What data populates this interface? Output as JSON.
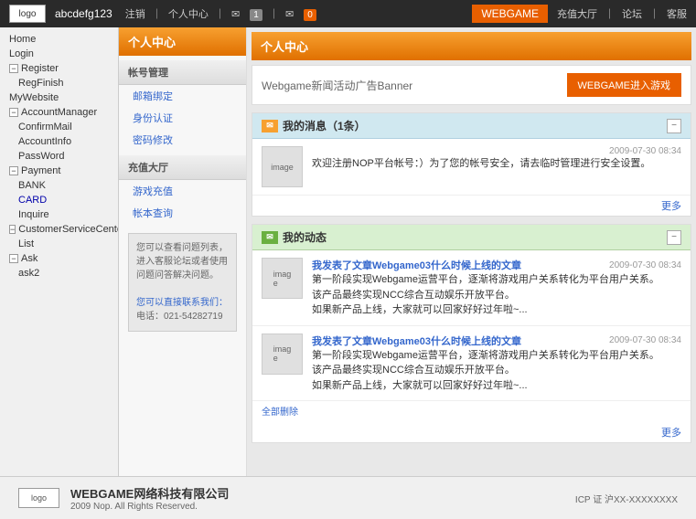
{
  "header": {
    "logo_text": "logo",
    "username": "abcdefg123",
    "links": {
      "logout": "注销",
      "profile": "个人中心",
      "mail_label": "",
      "badge_count": "1",
      "msg_label": "",
      "msg_count": "0"
    },
    "webgame_btn": "WEBGAME",
    "right_links": {
      "recharge": "充值大厅",
      "forum": "论坛",
      "service": "客服"
    }
  },
  "left_tree": {
    "items": [
      {
        "label": "Home",
        "level": 0,
        "has_expander": false
      },
      {
        "label": "Login",
        "level": 0,
        "has_expander": false
      },
      {
        "label": "Register",
        "level": 0,
        "has_expander": true,
        "expanded": true
      },
      {
        "label": "RegFinish",
        "level": 1,
        "has_expander": false
      },
      {
        "label": "MyWebsite",
        "level": 0,
        "has_expander": false
      },
      {
        "label": "AccountManager",
        "level": 0,
        "has_expander": true,
        "expanded": true
      },
      {
        "label": "ConfirmMail",
        "level": 1,
        "has_expander": false
      },
      {
        "label": "AccountInfo",
        "level": 1,
        "has_expander": false
      },
      {
        "label": "PassWord",
        "level": 1,
        "has_expander": false
      },
      {
        "label": "Payment",
        "level": 0,
        "has_expander": true,
        "expanded": true
      },
      {
        "label": "BANK",
        "level": 1,
        "has_expander": false
      },
      {
        "label": "CARD",
        "level": 1,
        "has_expander": false,
        "selected": true
      },
      {
        "label": "Inquire",
        "level": 1,
        "has_expander": false
      },
      {
        "label": "CustomerServiceCenter",
        "level": 0,
        "has_expander": true,
        "expanded": true
      },
      {
        "label": "List",
        "level": 1,
        "has_expander": false
      },
      {
        "label": "Ask",
        "level": 0,
        "has_expander": true,
        "expanded": true
      },
      {
        "label": "ask2",
        "level": 1,
        "has_expander": false
      }
    ]
  },
  "center_panel": {
    "title": "个人中心",
    "sections": [
      {
        "title": "帐号管理",
        "links": [
          "邮箱绑定",
          "身份认证",
          "密码修改"
        ]
      },
      {
        "title": "充值大厅",
        "links": [
          "游戏充值",
          "帐本查询"
        ]
      }
    ],
    "footer_text": "您可以查看问题列表，进入客服论坛或者使用问题问答解决问题。",
    "footer_link": "您可以直接联系我们：",
    "footer_phone": "电话：021-54282719"
  },
  "content": {
    "title": "个人中心",
    "banner_text": "Webgame新闻活动广告Banner",
    "webgame_enter_btn": "WEBGAME进入游戏",
    "messages_section": {
      "title": "我的消息（1条）",
      "items": [
        {
          "image_label": "image",
          "text": "欢迎注册NOP平台帐号：）为了您的帐号安全，请去临时管理进行安全设置。",
          "date": "2009-07-30 08:34"
        }
      ],
      "more_label": "更多"
    },
    "activity_section": {
      "title": "我的动态",
      "items": [
        {
          "image_label": "imag\ne",
          "article_title": "我发表了文章Webgame03什么时候上线的文章",
          "date": "2009-07-30 08:34",
          "lines": [
            "第一阶段实现Webgame运营平台，逐渐将游戏用户关系转化为平台用户关系。",
            "该产品最终实现NCC综合互动娱乐开放平台。",
            "如果新产品上线，大家就可以回家好好过年啦~..."
          ]
        },
        {
          "image_label": "imag\ne",
          "article_title": "我发表了文章Webgame03什么时候上线的文章",
          "date": "2009-07-30 08:34",
          "lines": [
            "第一阶段实现Webgame运营平台，逐渐将游戏用户关系转化为平台用户关系。",
            "该产品最终实现NCC综合互动娱乐开放平台。",
            "如果新产品上线，大家就可以回家好好过年啦~..."
          ]
        }
      ],
      "bottom_links": [
        "全部删除"
      ],
      "more_label": "更多"
    }
  },
  "footer": {
    "logo_text": "logo",
    "company": "WEBGAME网络科技有限公司",
    "copyright": "2009 Nop. All Rights Reserved.",
    "icp": "ICP 证 沪XX-XXXXXXXX"
  }
}
